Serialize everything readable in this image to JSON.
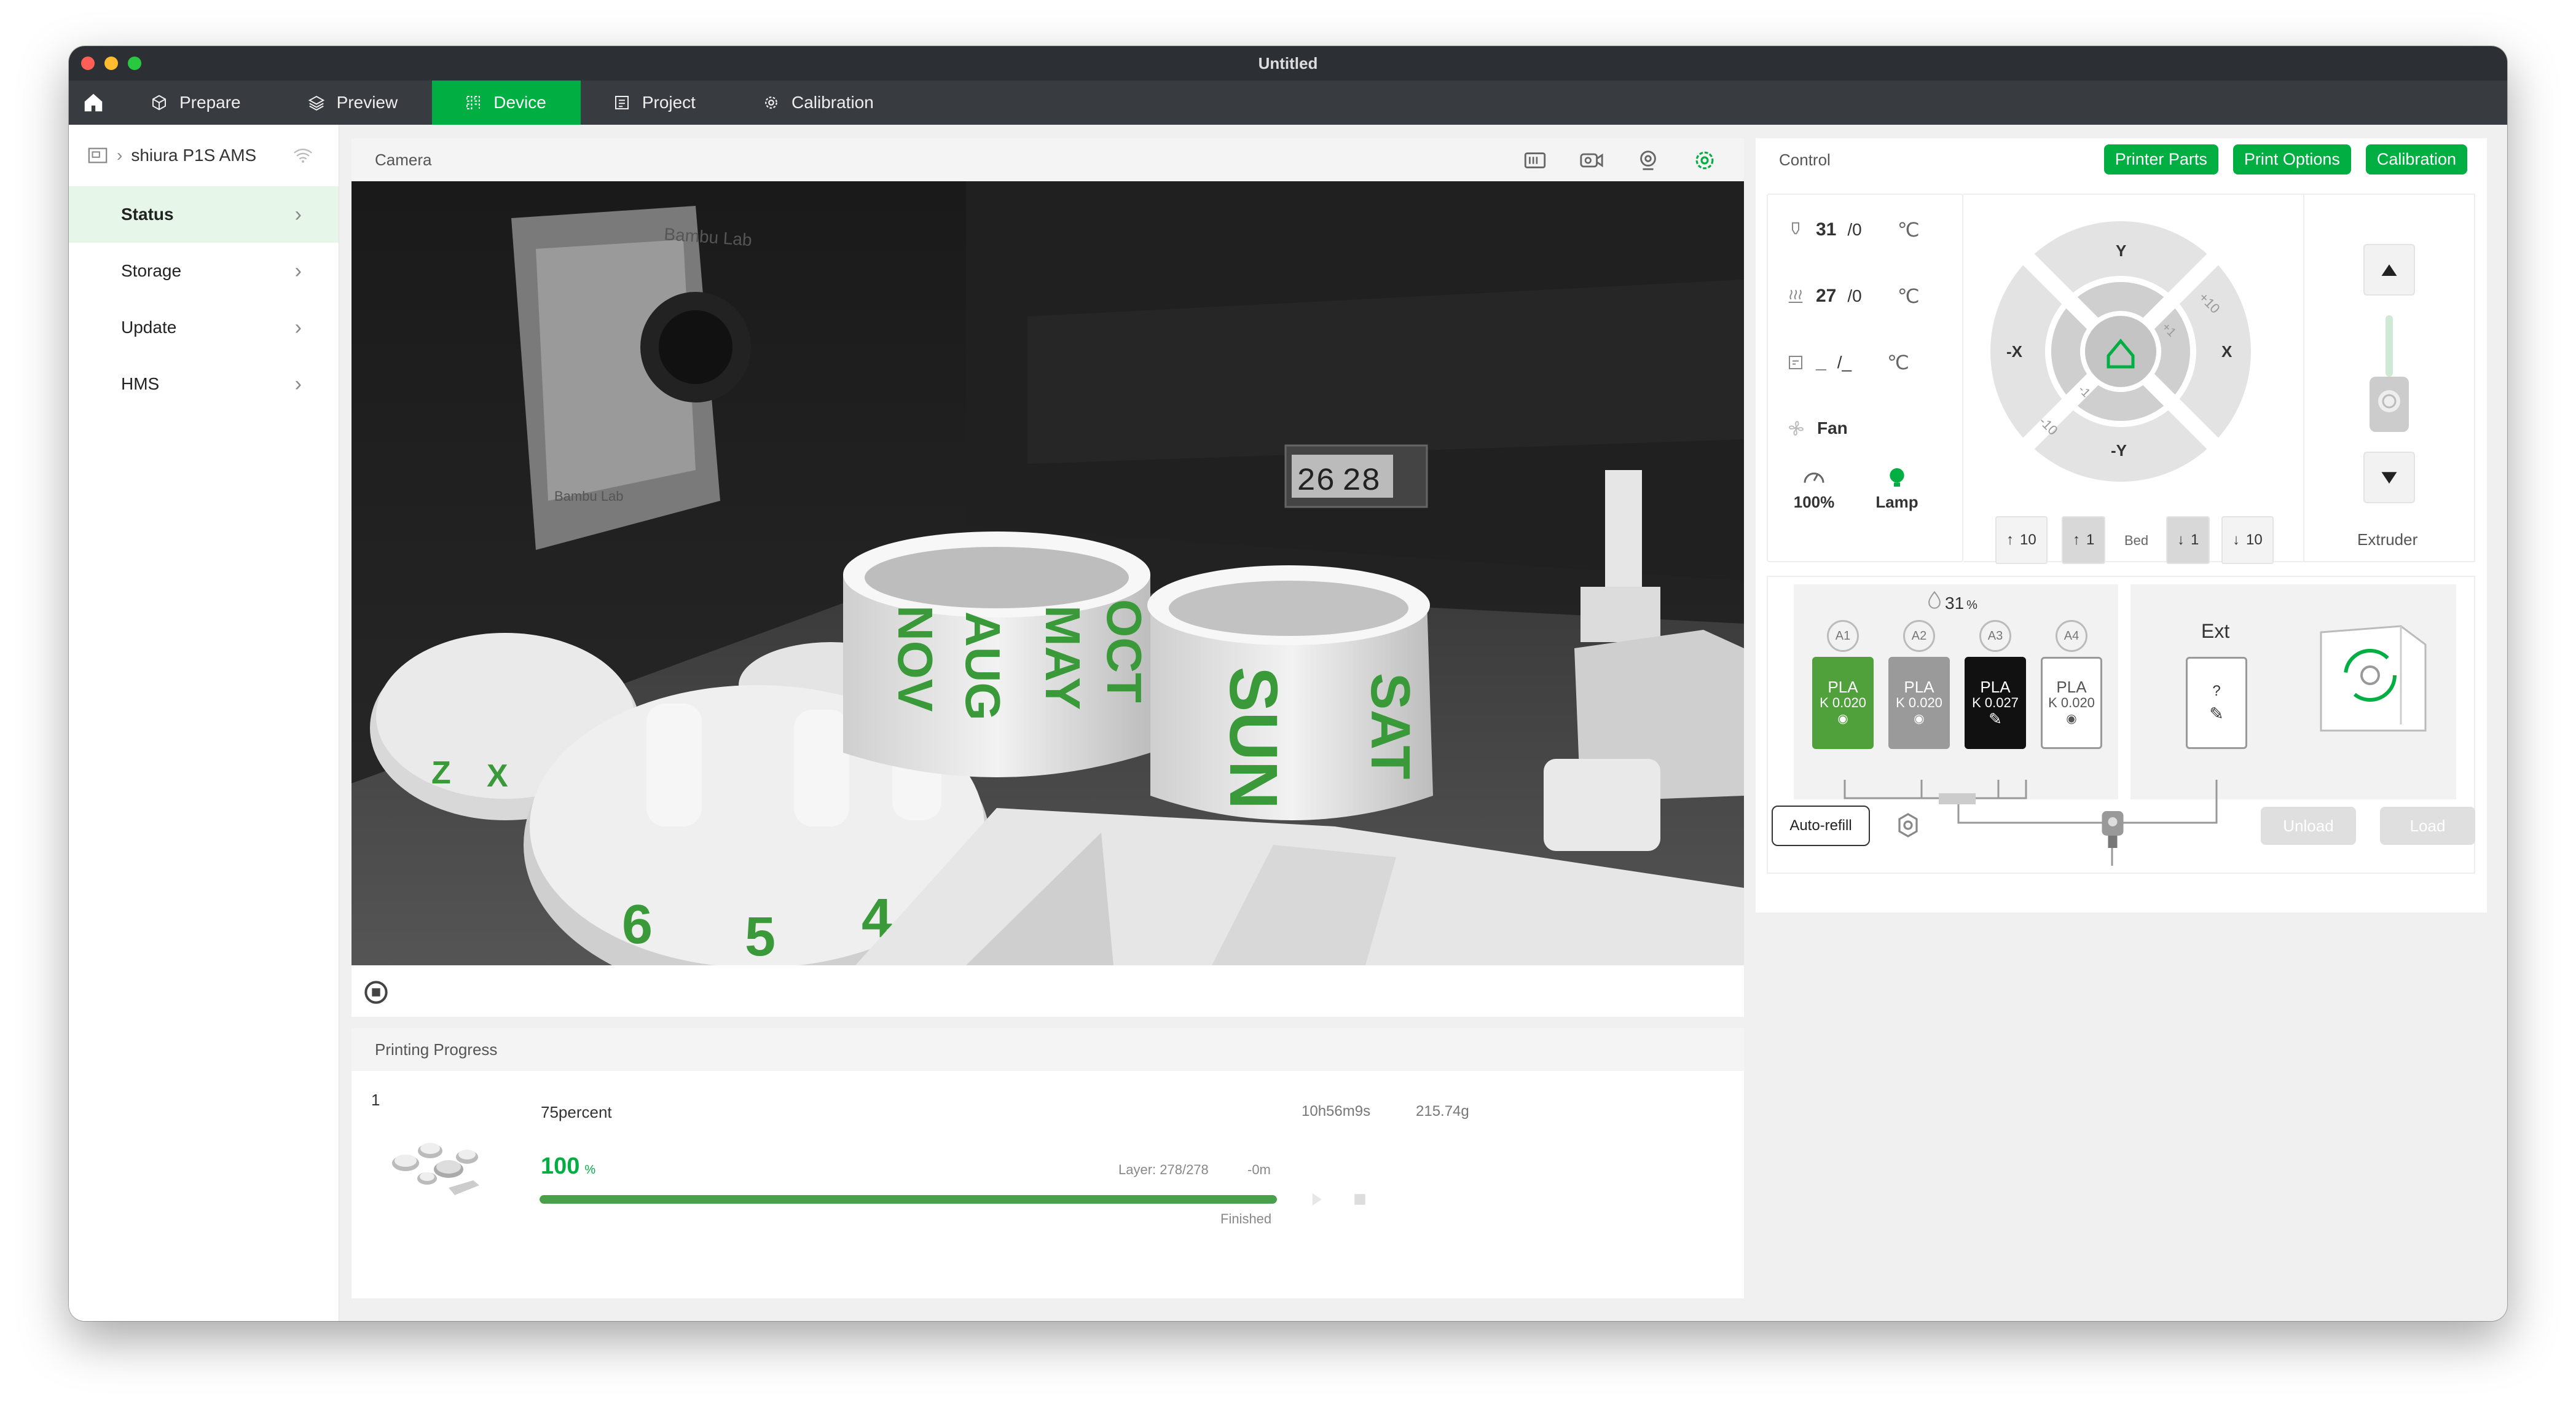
{
  "window": {
    "title": "Untitled"
  },
  "colors": {
    "accent": "#00ae42",
    "titlebar": "#2c2f33",
    "tabbar": "#383b3f"
  },
  "tabs": [
    {
      "label": "Prepare",
      "icon": "cube-icon"
    },
    {
      "label": "Preview",
      "icon": "layers-icon"
    },
    {
      "label": "Device",
      "icon": "device-icon"
    },
    {
      "label": "Project",
      "icon": "project-icon"
    },
    {
      "label": "Calibration",
      "icon": "calibration-icon"
    }
  ],
  "sidebar": {
    "device_name": "shiura P1S AMS",
    "items": [
      {
        "label": "Status"
      },
      {
        "label": "Storage"
      },
      {
        "label": "Update"
      },
      {
        "label": "HMS"
      }
    ]
  },
  "camera": {
    "title": "Camera",
    "scene_text": [
      "Bambu Lab",
      "Bambu Lab",
      "26",
      "28",
      "OCT",
      "MAY",
      "AUG",
      "NOV",
      "SUN",
      "SAT",
      "Z",
      "X",
      "6",
      "5",
      "4"
    ]
  },
  "progress": {
    "title": "Printing Progress",
    "plate": "1",
    "filename": "75percent",
    "time": "10h56m9s",
    "weight": "215.74g",
    "percent": "100",
    "percent_unit": "%",
    "progress_value": 1.0,
    "layer": "Layer: 278/278",
    "remaining": "-0m",
    "status": "Finished"
  },
  "control": {
    "title": "Control",
    "buttons": {
      "printer_parts": "Printer Parts",
      "print_options": "Print Options",
      "calibration": "Calibration"
    },
    "nozzle_temp": "31",
    "nozzle_target": "/0",
    "bed_temp": "27",
    "bed_target": "/0",
    "chamber_temp": "_",
    "chamber_target": "/_",
    "temp_unit": "℃",
    "fan_label": "Fan",
    "speed_value": "100%",
    "lamp_label": "Lamp",
    "jog": {
      "y": "Y",
      "neg_y": "-Y",
      "x": "X",
      "neg_x": "-X",
      "plus10": "+10",
      "plus1": "+1",
      "minus1": "-1",
      "minus10": "-10"
    },
    "bed": {
      "up10": "10",
      "up1": "1",
      "label": "Bed",
      "down1": "1",
      "down10": "10"
    },
    "extruder_label": "Extruder"
  },
  "ams": {
    "humidity": "31",
    "humidity_unit": "%",
    "slots": [
      {
        "id": "A1",
        "material": "PLA",
        "k": "K 0.020",
        "color": "#50a03c",
        "text_color": "#ffffff"
      },
      {
        "id": "A2",
        "material": "PLA",
        "k": "K 0.020",
        "color": "#9a9a9a",
        "text_color": "#ffffff"
      },
      {
        "id": "A3",
        "material": "PLA",
        "k": "K 0.027",
        "color": "#111111",
        "text_color": "#ffffff"
      },
      {
        "id": "A4",
        "material": "PLA",
        "k": "K 0.020",
        "color": "#ffffff",
        "text_color": "#555555"
      }
    ],
    "ext_label": "Ext",
    "ext_slot": "?",
    "auto_refill": "Auto-refill",
    "unload": "Unload",
    "load": "Load"
  }
}
